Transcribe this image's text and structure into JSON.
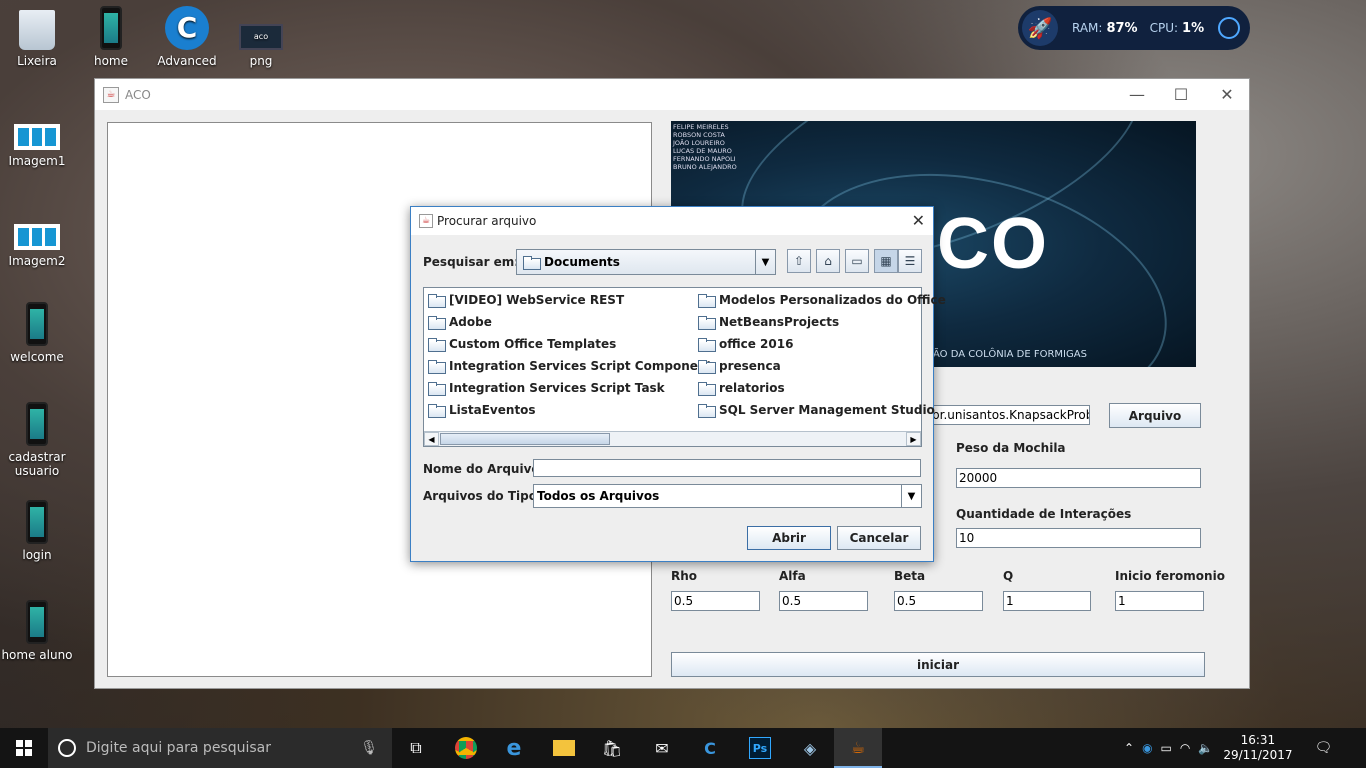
{
  "desktop": {
    "icons": [
      {
        "label": "Lixeira"
      },
      {
        "label": "home\npr..."
      },
      {
        "label": "Advanced\nSyst..."
      },
      {
        "label": "png"
      },
      {
        "label": "Imagem1"
      },
      {
        "label": "Imagem2"
      },
      {
        "label": "welcome"
      },
      {
        "label": "cadastrar\nusuario"
      },
      {
        "label": "login"
      },
      {
        "label": "home aluno"
      }
    ],
    "widget": {
      "ram_label": "RAM:",
      "ram_value": "87%",
      "cpu_label": "CPU:",
      "cpu_value": "1%"
    }
  },
  "aco_window": {
    "title": "ACO",
    "banner": {
      "names": [
        "FELIPE MEIRELES",
        "ROBSON COSTA",
        "JOÃO LOUREIRO",
        "LUCAS DE MAURO",
        "FERNANDO NAPOLI",
        "BRUNO ALEJANDRO"
      ],
      "big_text": "CO",
      "subtitle": "ÃO DA COLÔNIA DE FORMIGAS"
    },
    "file_field_value": "br.unisantos.KnapsackProbl",
    "arquivo_button": "Arquivo",
    "peso_label": "Peso da Mochila",
    "peso_value": "20000",
    "interacoes_label": "Quantidade de Interações",
    "interacoes_value": "10",
    "params": [
      {
        "label": "Rho",
        "value": "0.5"
      },
      {
        "label": "Alfa",
        "value": "0.5"
      },
      {
        "label": "Beta",
        "value": "0.5"
      },
      {
        "label": "Q",
        "value": "1"
      },
      {
        "label": "Inicio feromonio",
        "value": "1"
      }
    ],
    "iniciar_button": "iniciar"
  },
  "dialog": {
    "title": "Procurar arquivo",
    "look_in_label": "Pesquisar em:",
    "look_in_value": "Documents",
    "files_col1": [
      "[VIDEO] WebService REST",
      "Adobe",
      "Custom Office Templates",
      "Integration Services Script Component",
      "Integration Services Script Task",
      "ListaEventos"
    ],
    "files_col2": [
      "Modelos Personalizados do Office",
      "NetBeansProjects",
      "office 2016",
      "presenca",
      "relatorios",
      "SQL Server Management Studio"
    ],
    "filename_label": "Nome do Arquivo:",
    "filename_value": "",
    "filetype_label": "Arquivos do Tipo:",
    "filetype_value": "Todos os Arquivos",
    "open_button": "Abrir",
    "cancel_button": "Cancelar"
  },
  "taskbar": {
    "search_placeholder": "Digite aqui para pesquisar",
    "time": "16:31",
    "date": "29/11/2017"
  }
}
